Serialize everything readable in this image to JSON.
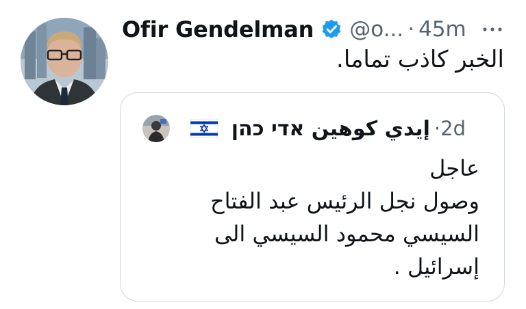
{
  "tweet": {
    "author_name": "Ofir Gendelman",
    "handle": "@o...",
    "separator": "·",
    "time": "45m",
    "verified": true,
    "more_icon": "more-horizontal-icon",
    "text": "الخبر كاذب تماما."
  },
  "quoted_tweet": {
    "author_name": "إيدي كوهين אדי כהן",
    "flag": "israel-flag-emoji",
    "separator": "·",
    "time": "2d",
    "lines": [
      "عاجل",
      "وصول نجل الرئيس عبد الفتاح",
      "السيسي محمود السيسي الى",
      "إسرائيل ."
    ]
  },
  "colors": {
    "text_primary": "#0f1419",
    "text_secondary": "#536471",
    "verified_blue": "#1d9bf0",
    "border": "#cfd9de"
  }
}
